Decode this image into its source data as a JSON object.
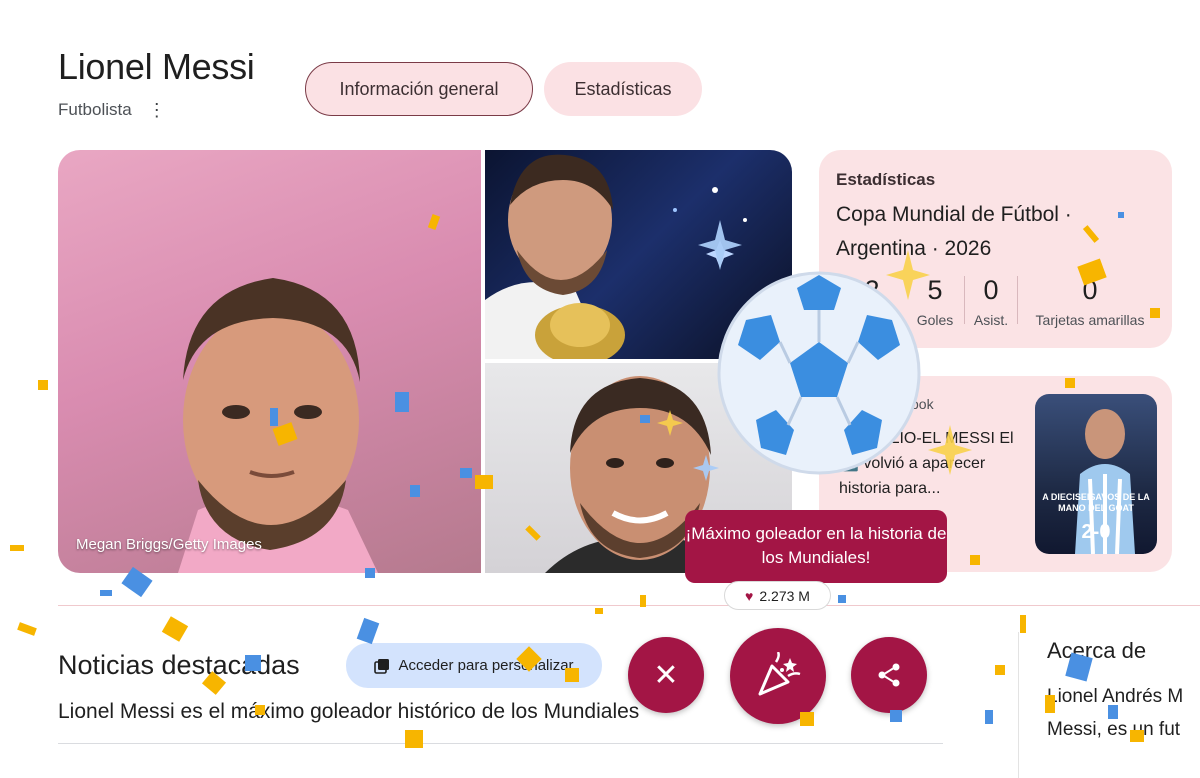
{
  "header": {
    "title": "Lionel Messi",
    "subtitle": "Futbolista"
  },
  "tabs": [
    {
      "label": "Información general",
      "active": true
    },
    {
      "label": "Estadísticas",
      "active": false
    }
  ],
  "photos": {
    "credit": "Megan Briggs/Getty Images"
  },
  "stats_card": {
    "label": "Estadísticas",
    "competition": "Copa Mundial de Fútbol · Argentina · 2026",
    "stats": [
      {
        "value": "2",
        "label": ""
      },
      {
        "value": "5",
        "label": "Goles"
      },
      {
        "value": "0",
        "label": "Asist."
      },
      {
        "value": "0",
        "label": "Tarjetas amarillas"
      }
    ]
  },
  "news_card": {
    "source": "ook",
    "text": "NTINA LIO-EL MESSI El 🔟 volvió a aparecer historia para...",
    "thumb_caption": "A DIECISEISAVOS DE LA MANO DEL GOAT",
    "thumb_score": "2-0"
  },
  "celebration": {
    "message": "¡Máximo goleador en la historia de los Mundiales!",
    "likes": "2.273 M"
  },
  "news_section": {
    "title": "Noticias destacadas",
    "personalize_label": "Acceder para personalizar",
    "headline": "Lionel Messi es el máximo goleador histórico de los Mundiales"
  },
  "about": {
    "title": "Acerca de",
    "text_line1": "Lionel Andrés M",
    "text_line2": "Messi, es un fut"
  },
  "colors": {
    "accent": "#a31545",
    "chip_bg": "#fbe1e4",
    "card_bg": "#fbe3e5",
    "ball_blue": "#3b8ee0"
  },
  "icons": {
    "menu": "more-vert-icon",
    "personalize": "collections-icon",
    "close": "close-icon",
    "celebrate": "party-popper-icon",
    "share": "share-icon",
    "heart": "heart-icon",
    "ball": "soccer-ball-sticker"
  }
}
